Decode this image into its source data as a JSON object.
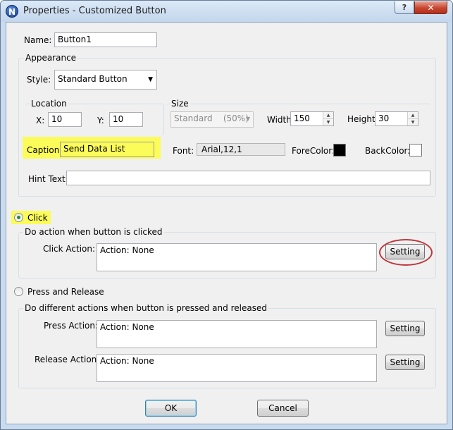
{
  "window": {
    "title": "Properties - Customized Button",
    "help_glyph": "?",
    "close_glyph": "✕",
    "app_glyph": "N"
  },
  "name": {
    "label": "Name:",
    "value": "Button1"
  },
  "appearance": {
    "group_label": "Appearance",
    "style_label": "Style:",
    "style_value": "Standard Button",
    "location_label": "Location",
    "x_label": "X:",
    "x_value": "10",
    "y_label": "Y:",
    "y_value": "10",
    "size_label": "Size",
    "size_value": "Standard    (50%)",
    "width_label": "Width:",
    "width_value": "150",
    "height_label": "Height:",
    "height_value": "30",
    "caption_label": "Caption:",
    "caption_value": "Send Data List",
    "font_label": "Font:",
    "font_value": "Arial,12,1",
    "forecolor_label": "ForeColor:",
    "forecolor": "#000000",
    "backcolor_label": "BackColor:",
    "backcolor": "#ffffff",
    "hint_label": "Hint Text:",
    "hint_value": ""
  },
  "click_mode": {
    "label": "Click",
    "selected": true,
    "group_label": "Do action when button is clicked",
    "action_label": "Click Action:",
    "action_value": "Action: None",
    "setting_label": "Setting"
  },
  "press_mode": {
    "label": "Press and Release",
    "selected": false,
    "group_label": "Do different actions when button is pressed and released",
    "press_label": "Press Action:",
    "press_value": "Action: None",
    "press_setting": "Setting",
    "release_label": "Release Action:",
    "release_value": "Action: None",
    "release_setting": "Setting"
  },
  "footer": {
    "ok_label": "OK",
    "cancel_label": "Cancel"
  },
  "colors": {
    "highlight": "#fbfb5a",
    "annotation_ring": "#c0353a"
  }
}
